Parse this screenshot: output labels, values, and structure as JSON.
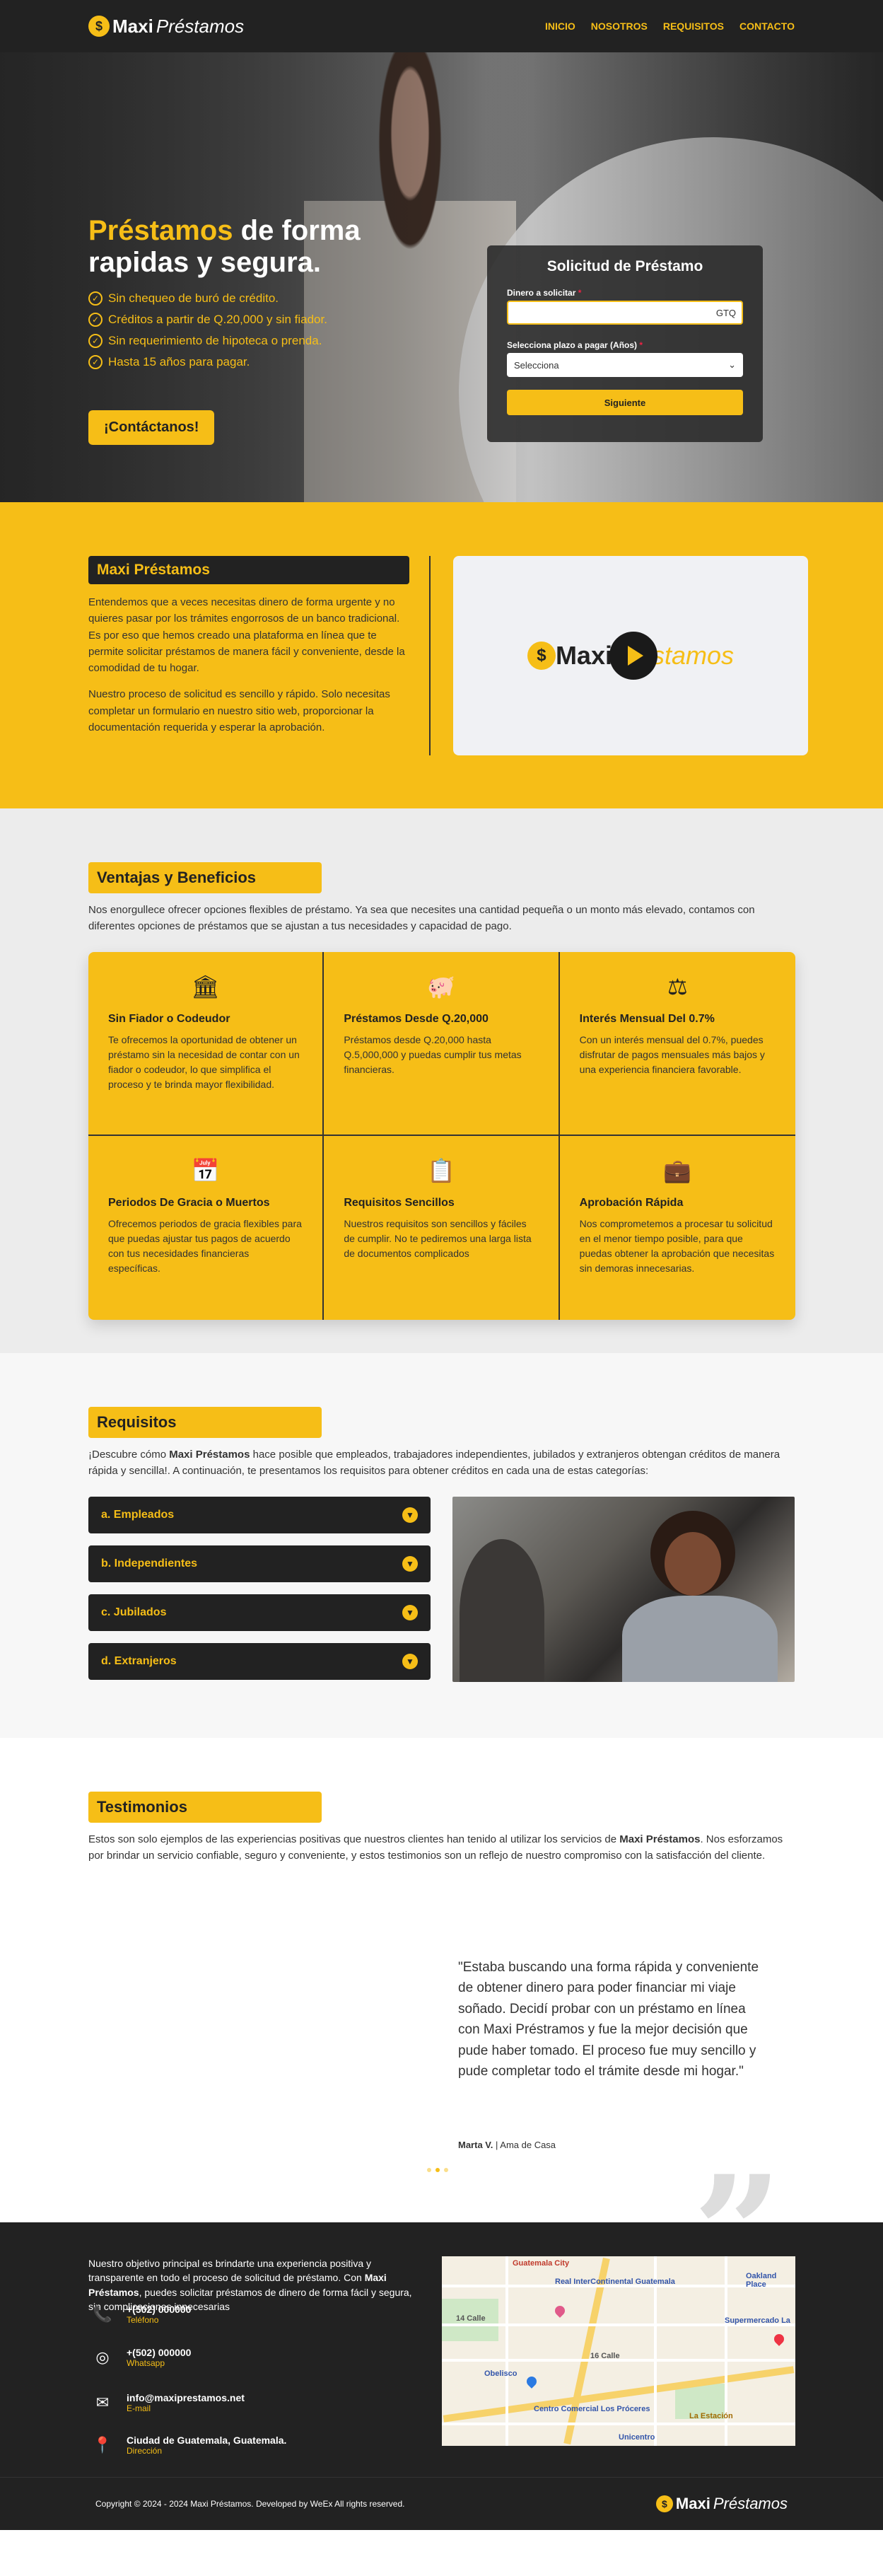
{
  "brand": {
    "logo_mark": "$",
    "logo_bold": "Maxi",
    "logo_italic": "Préstamos"
  },
  "nav": {
    "items": [
      "INICIO",
      "NOSOTROS",
      "REQUISITOS",
      "CONTACTO"
    ]
  },
  "hero": {
    "title_highlight": "Préstamos",
    "title_rest": " de forma rapidas y segura.",
    "checks": [
      "Sin chequeo de buró de crédito.",
      "Créditos a partir de Q.20,000 y sin fiador.",
      "Sin requerimiento de hipoteca o prenda.",
      "Hasta 15 años para pagar."
    ],
    "cta": "¡Contáctanos!"
  },
  "form": {
    "title": "Solicitud de Préstamo",
    "amount_label": "Dinero a solicitar",
    "amount_suffix": "GTQ",
    "term_label": "Selecciona plazo a pagar (Años)",
    "term_value": "Selecciona",
    "required_mark": "*",
    "submit": "Siguiente"
  },
  "about": {
    "title": "Maxi Préstamos",
    "p1": "Entendemos que a veces necesitas dinero de forma urgente y no quieres pasar por los trámites engorrosos de un banco tradicional. Es por eso que hemos creado una plataforma en línea que te permite solicitar préstamos de manera fácil y conveniente, desde la comodidad de tu hogar.",
    "p2": "Nuestro proceso de solicitud es sencillo y rápido. Solo necesitas completar un formulario en nuestro sitio web, proporcionar la documentación requerida y esperar la aprobación."
  },
  "benefits": {
    "title": "Ventajas y Beneficios",
    "intro": "Nos enorgullece ofrecer opciones flexibles de préstamo. Ya sea que necesites una cantidad pequeña o un monto más elevado, contamos con diferentes opciones de préstamos que se ajustan a tus necesidades y capacidad de pago.",
    "items": [
      {
        "icon": "bank-icon",
        "glyph": "🏛",
        "title": "Sin Fiador o Codeudor",
        "text": "Te ofrecemos la oportunidad de obtener un préstamo sin la necesidad de contar con un fiador o codeudor, lo que simplifica el proceso y te brinda mayor flexibilidad."
      },
      {
        "icon": "piggy-bank-icon",
        "glyph": "🐖",
        "title": "Préstamos Desde Q.20,000",
        "text": "Préstamos desde Q.20,000 hasta Q.5,000,000 y puedas cumplir tus metas financieras."
      },
      {
        "icon": "scale-icon",
        "glyph": "⚖",
        "title": "Interés Mensual Del 0.7%",
        "text": "Con un interés mensual del 0.7%, puedes disfrutar de pagos mensuales más bajos y una experiencia financiera favorable."
      },
      {
        "icon": "calendar-icon",
        "glyph": "📅",
        "title": "Periodos De Gracia o Muertos",
        "text": "Ofrecemos periodos de gracia flexibles para que puedas ajustar tus pagos de acuerdo con tus necesidades financieras específicas."
      },
      {
        "icon": "clipboard-icon",
        "glyph": "📋",
        "title": "Requisitos Sencillos",
        "text": "Nuestros requisitos son sencillos y fáciles de cumplir. No te pediremos una larga lista de documentos complicados"
      },
      {
        "icon": "business-time-icon",
        "glyph": "💼",
        "title": "Aprobación Rápida",
        "text": "Nos comprometemos a procesar tu solicitud en el menor tiempo posible, para que puedas obtener la aprobación que necesitas sin demoras innecesarias."
      }
    ]
  },
  "requirements": {
    "title": "Requisitos",
    "intro_a": "¡Descubre cómo ",
    "intro_b": "Maxi Préstamos",
    "intro_c": " hace posible que empleados, trabajadores independientes, jubilados y extranjeros obtengan créditos de manera rápida y sencilla!. A continuación, te presentamos los requisitos para obtener créditos en cada una de estas categorías:",
    "items": [
      "a. Empleados",
      "b. Independientes",
      "c. Jubilados",
      "d. Extranjeros"
    ]
  },
  "testimonials": {
    "title": "Testimonios",
    "intro_a": "Estos son solo ejemplos de las experiencias positivas que nuestros clientes han tenido al utilizar los servicios de ",
    "intro_b": "Maxi Préstamos",
    "intro_c": ". Nos esforzamos por brindar un servicio confiable, seguro y conveniente, y estos testimonios son un reflejo de nuestro compromiso con la satisfacción del cliente.",
    "quote": "\"Estaba buscando una forma rápida y conveniente de obtener dinero para poder financiar mi viaje soñado. Decidí probar con un préstamo en línea con Maxi Préstramos y fue la mejor decisión que pude haber tomado. El proceso fue muy sencillo y pude completar todo el trámite desde mi hogar.\"",
    "author": "Marta V.",
    "role": " | Ama de Casa",
    "big_quote": "”"
  },
  "footer": {
    "text_a": "Nuestro objetivo principal es brindarte una experiencia positiva y transparente en todo el proceso de solicitud de préstamo. Con ",
    "text_b": "Maxi Préstamos",
    "text_c": ", puedes solicitar préstamos de dinero de forma fácil y segura, sin complicaciones innecesarias",
    "contacts": [
      {
        "icon": "phone-icon",
        "glyph": "📞",
        "main": "+(502) 000000",
        "sub": "Teléfono"
      },
      {
        "icon": "whatsapp-icon",
        "glyph": "◎",
        "main": "+(502) 000000",
        "sub": "Whatsapp"
      },
      {
        "icon": "envelope-icon",
        "glyph": "✉",
        "main": "info@maxiprestamos.net",
        "sub": "E-mail"
      },
      {
        "icon": "location-pin-icon",
        "glyph": "📍",
        "main": "Ciudad de Guatemala, Guatemala.",
        "sub": "Dirección"
      }
    ],
    "map_labels": [
      "Real InterContinental Guatemala",
      "Oakland Place",
      "Supermercado La",
      "Centro Comercial Los Próceres",
      "La Estación",
      "Obelisco",
      "Unicentro",
      "Guatemala City",
      "14 Calle",
      "16 Calle"
    ],
    "copyright": "Copyright © 2024 - 2024 Maxi Préstamos. Developed by WeEx All rights reserved."
  }
}
